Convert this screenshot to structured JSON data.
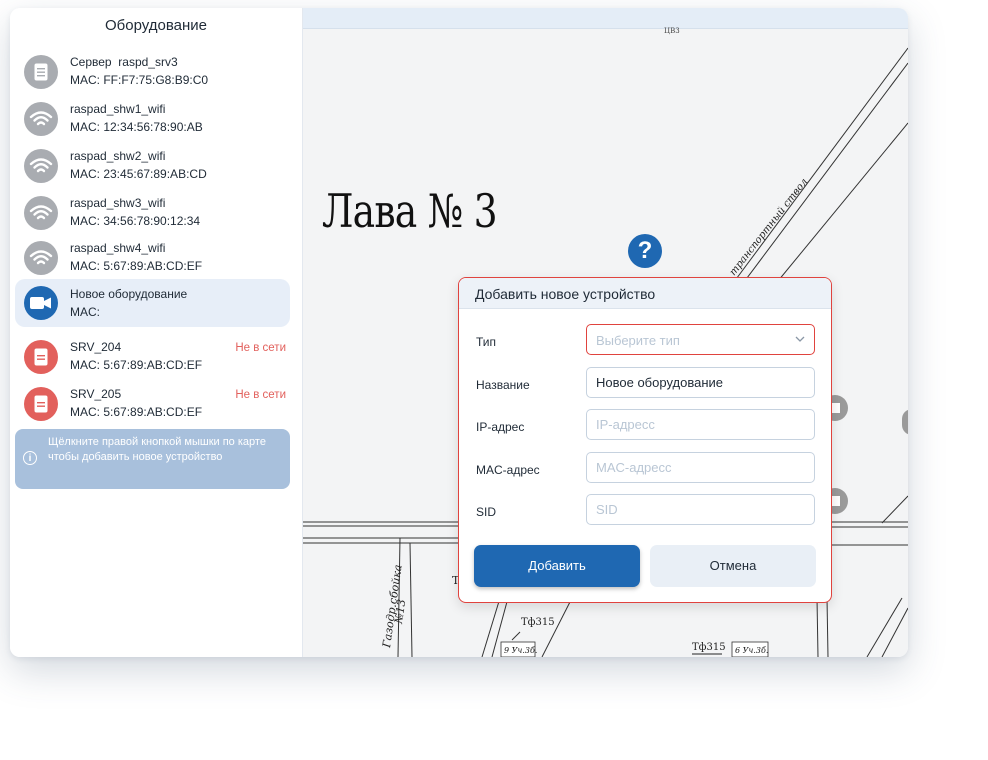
{
  "sidebar": {
    "title": "Оборудование",
    "devices": [
      {
        "name": "Сервер  raspd_srv3",
        "mac": "MAC: FF:F7:75:G8:B9:C0",
        "icon": "server-icon",
        "status": ""
      },
      {
        "name": "raspad_shw1_wifi",
        "mac": "MAC: 12:34:56:78:90:AB",
        "icon": "wifi-icon",
        "status": ""
      },
      {
        "name": "raspad_shw2_wifi",
        "mac": "MAC: 23:45:67:89:AB:CD",
        "icon": "wifi-icon",
        "status": ""
      },
      {
        "name": "raspad_shw3_wifi",
        "mac": "MAC: 34:56:78:90:12:34",
        "icon": "wifi-icon",
        "status": ""
      },
      {
        "name": "raspad_shw4_wifi",
        "mac": "MAC: 5:67:89:AB:CD:EF",
        "icon": "wifi-icon",
        "status": ""
      },
      {
        "name": "Новое оборудование",
        "mac": "MAC:",
        "icon": "camera-icon",
        "status": ""
      },
      {
        "name": "SRV_204",
        "mac": "MAC: 5:67:89:AB:CD:EF",
        "icon": "server-icon",
        "status": "Не в сети"
      },
      {
        "name": "SRV_205",
        "mac": "MAC: 5:67:89:AB:CD:EF",
        "icon": "server-icon",
        "status": "Не в сети"
      }
    ],
    "info_text": "Щёлкните правой кнопкой мышки по карте чтобы добавить новое устройство",
    "info_icon": "info-icon"
  },
  "map": {
    "title": "Лава № 3",
    "help_label": "?",
    "labels": {
      "shaft": "транспортный ствол",
      "gas": "Газодр.сбойка",
      "gas_no": "№13",
      "tf1": "Тф315",
      "tf2": "Тф315",
      "uch1": "9 Уч.3б.",
      "uch2": "6 Уч.3б.",
      "top": "ЦВ3"
    }
  },
  "dialog": {
    "title": "Добавить новое устройство",
    "fields": {
      "type": {
        "label": "Тип",
        "placeholder": "Выберите тип"
      },
      "name": {
        "label": "Название",
        "value": "Новое оборудование"
      },
      "ip": {
        "label": "IP-адрес",
        "placeholder": "IP-адресс"
      },
      "mac": {
        "label": "MAC-адрес",
        "placeholder": "MAC-адресс"
      },
      "sid": {
        "label": "SID",
        "placeholder": "SID"
      }
    },
    "add_label": "Добавить",
    "cancel_label": "Отмена"
  },
  "colors": {
    "accent": "#1f68b2",
    "offline": "#e2605c",
    "neutral_icon": "#a9acb1",
    "error_border": "#e0433e",
    "info_bg": "#a8c0dc",
    "selected_bg": "#e7eef8"
  }
}
